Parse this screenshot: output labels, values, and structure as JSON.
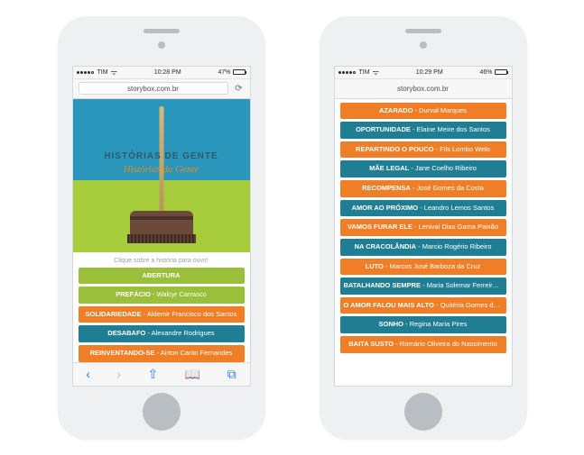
{
  "colors": {
    "green": "#9abf3b",
    "orange": "#f07e26",
    "teal": "#1f7e94"
  },
  "phone1": {
    "status": {
      "carrier": "TIM",
      "signal_dots": 4,
      "wifi": true,
      "time": "10:28 PM",
      "battery_pct": "47%"
    },
    "url": "storybox.com.br",
    "hero": {
      "line1": "HISTÓRIAS DE GENTE",
      "line2": "Histórias da Gente"
    },
    "prompt": "Clique sobre a história para ouvir!",
    "items": [
      {
        "title": "ABERTURA",
        "author": "",
        "color": "green"
      },
      {
        "title": "PREFÁCIO",
        "author": "Walcyr Carrasco",
        "color": "green"
      },
      {
        "title": "SOLIDARIEDADE",
        "author": "Aldemir Francisco dos Santos",
        "color": "orange"
      },
      {
        "title": "DESABAFO",
        "author": "Alexandre Rodrigues",
        "color": "teal"
      },
      {
        "title": "REINVENTANDO-SE",
        "author": "Airton Canto Fernandes",
        "color": "orange"
      }
    ],
    "tabbar": {
      "back": "‹",
      "forward": "›",
      "share": "⎋",
      "bookmarks": "▢",
      "tabs": "⧉"
    }
  },
  "phone2": {
    "status": {
      "carrier": "TIM",
      "signal_dots": 4,
      "wifi": true,
      "time": "10:29 PM",
      "battery_pct": "46%"
    },
    "url": "storybox.com.br",
    "items": [
      {
        "title": "AZARADO",
        "author": "Durval Marques",
        "color": "orange"
      },
      {
        "title": "OPORTUNIDADE",
        "author": "Elaine Meire dos Santos",
        "color": "teal"
      },
      {
        "title": "REPARTINDO O POUCO",
        "author": "Fils Lombo Welo",
        "color": "orange"
      },
      {
        "title": "MÃE LEGAL",
        "author": "Jane Coelho Ribeiro",
        "color": "teal"
      },
      {
        "title": "RECOMPENSA",
        "author": "José Gomes da Costa",
        "color": "orange"
      },
      {
        "title": "AMOR AO PRÓXIMO",
        "author": "Leandro Lemos Santos",
        "color": "teal"
      },
      {
        "title": "VAMOS FURAR ELE",
        "author": "Lenival Dias Gama Paixão",
        "color": "orange"
      },
      {
        "title": "NA CRACOLÂNDIA",
        "author": "Marcio Rogério Ribeiro",
        "color": "teal"
      },
      {
        "title": "LUTO",
        "author": "Marcos José Barboza da Cruz",
        "color": "orange"
      },
      {
        "title": "BATALHANDO SEMPRE",
        "author": "Maria Solemar Ferreira da Silva",
        "color": "teal"
      },
      {
        "title": "O AMOR FALOU MAIS ALTO",
        "author": "Quitéria Gomes de Araújo",
        "color": "orange"
      },
      {
        "title": "SONHO",
        "author": "Regina Maria Pires",
        "color": "teal"
      },
      {
        "title": "BAITA SUSTO",
        "author": "Romário Oliveira do Nascimento",
        "color": "orange"
      }
    ]
  }
}
